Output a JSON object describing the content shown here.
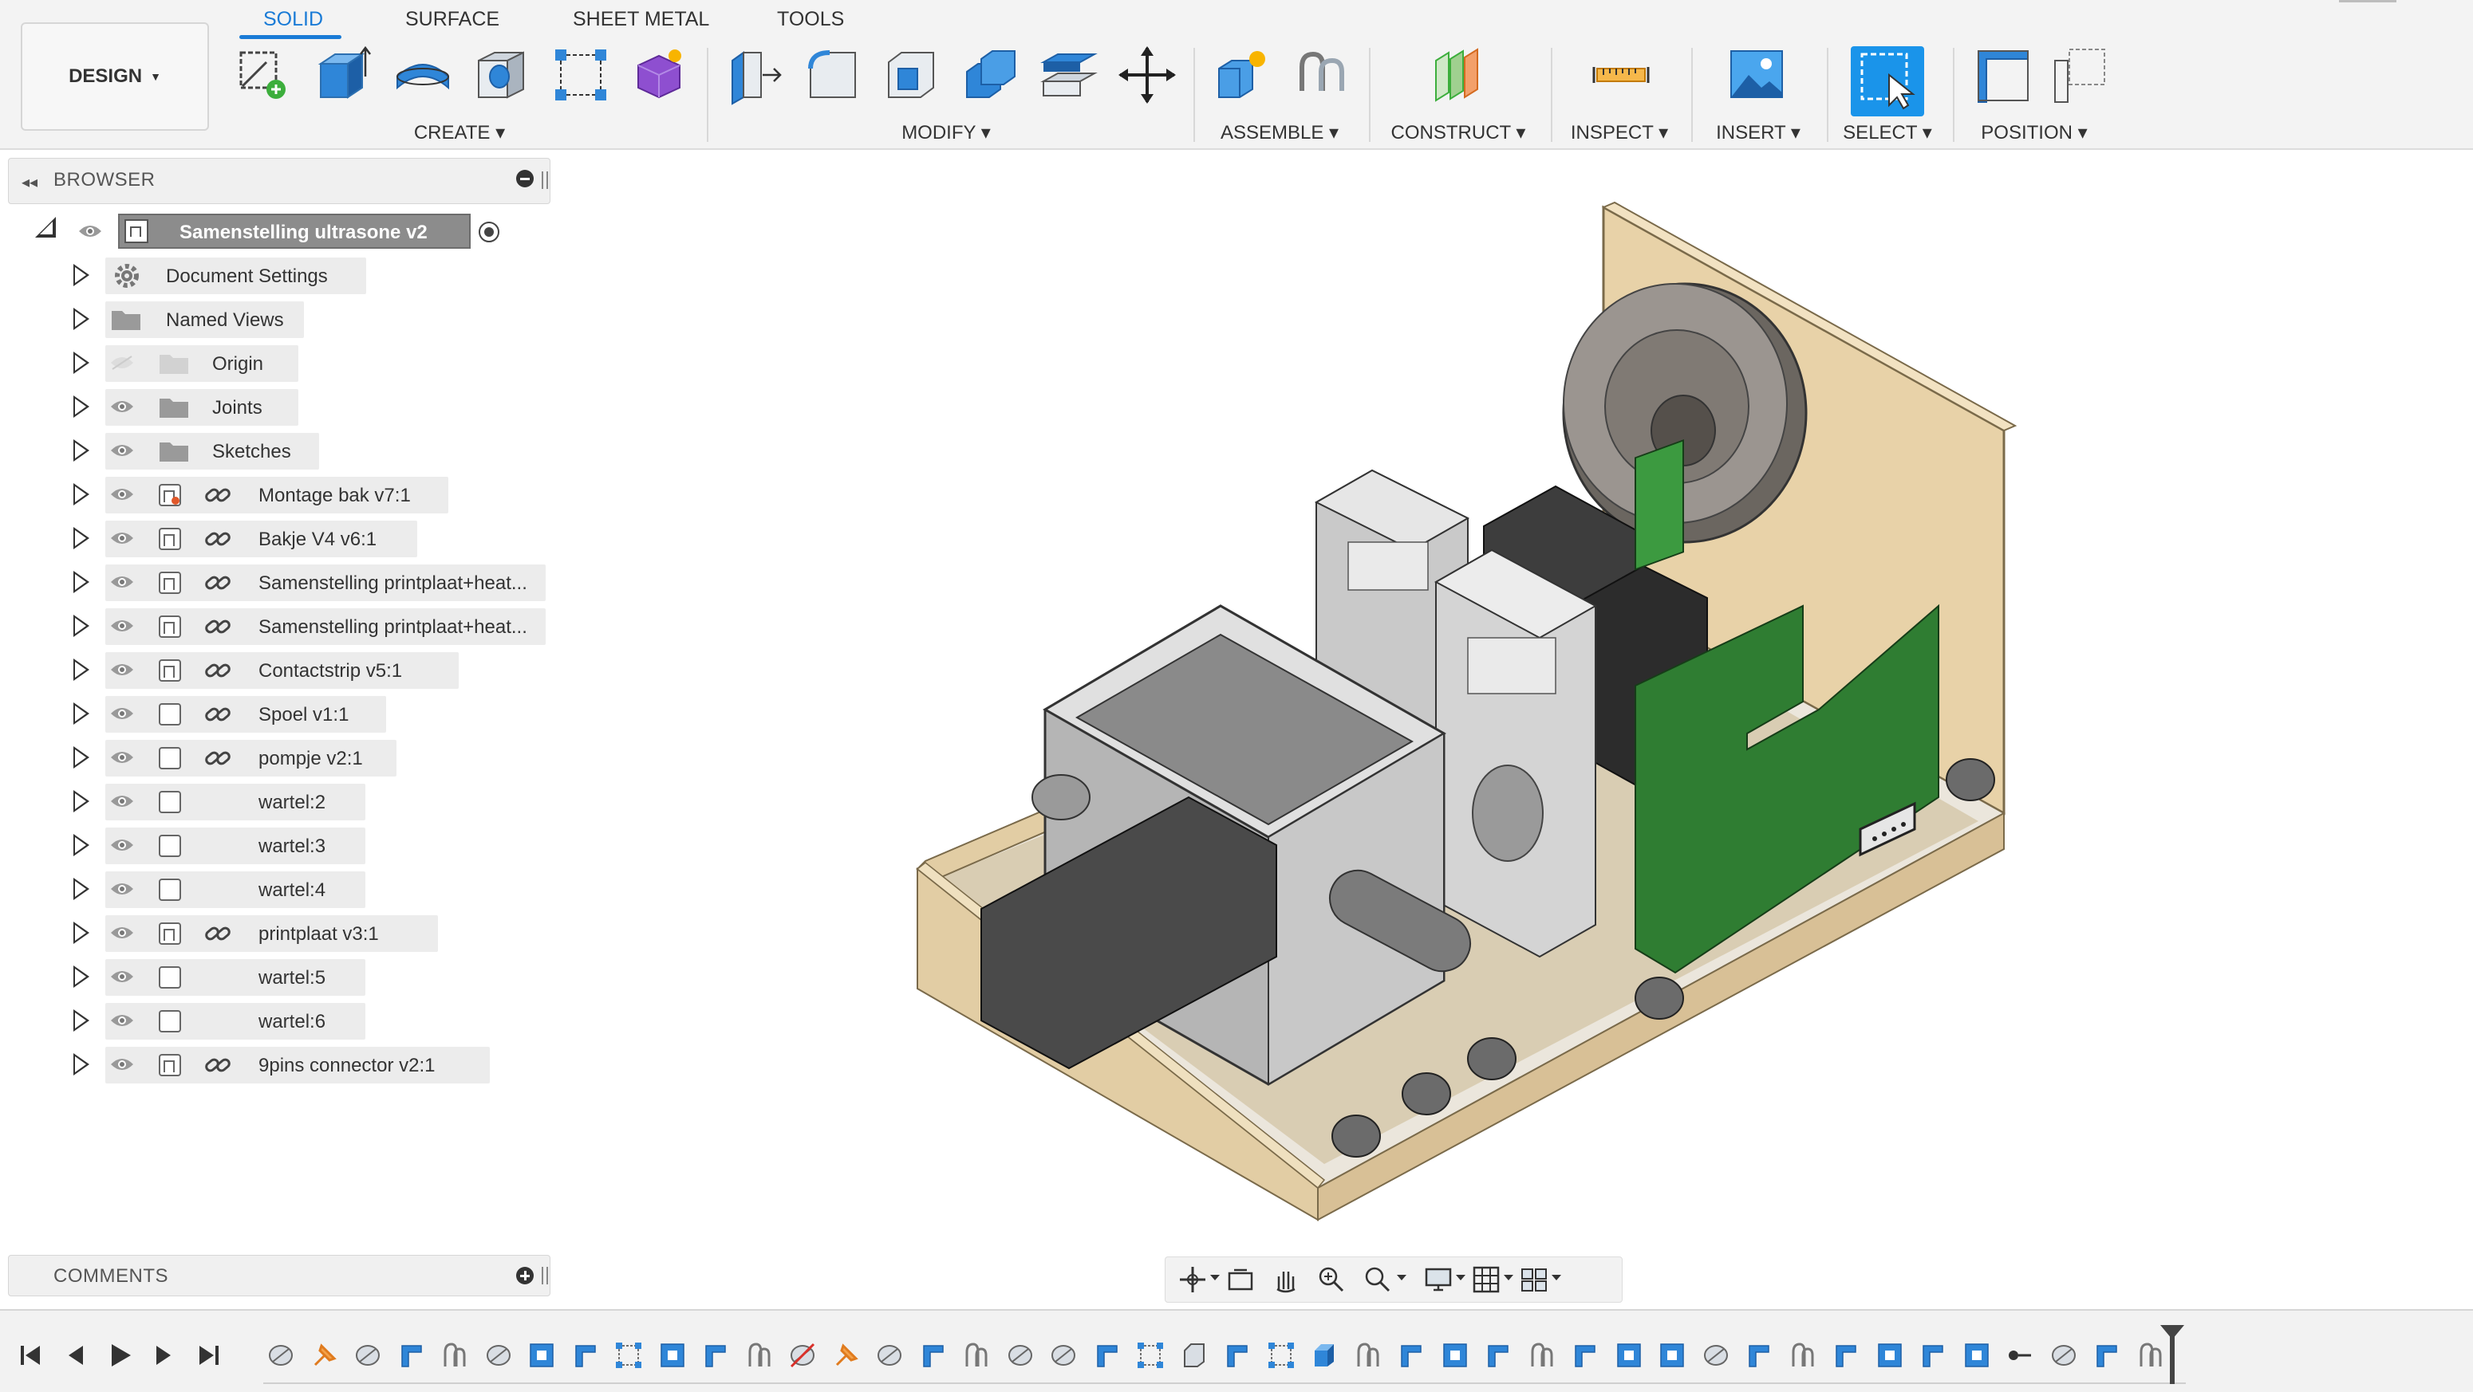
{
  "toolbar": {
    "design_label": "DESIGN",
    "tabs": [
      {
        "label": "SOLID",
        "active": true
      },
      {
        "label": "SURFACE",
        "active": false
      },
      {
        "label": "SHEET METAL",
        "active": false
      },
      {
        "label": "TOOLS",
        "active": false
      }
    ],
    "groups": {
      "create": "CREATE",
      "modify": "MODIFY",
      "assemble": "ASSEMBLE",
      "construct": "CONSTRUCT",
      "inspect": "INSPECT",
      "insert": "INSERT",
      "select": "SELECT",
      "position": "POSITION"
    }
  },
  "browser": {
    "title": "BROWSER",
    "root": "Samenstelling ultrasone v2",
    "items": [
      {
        "label": "Document Settings",
        "icon": "gear-icon"
      },
      {
        "label": "Named Views",
        "icon": "folder-icon"
      },
      {
        "label": "Origin",
        "icon": "folder-icon",
        "hidden": true
      },
      {
        "label": "Joints",
        "icon": "folder-icon"
      },
      {
        "label": "Sketches",
        "icon": "folder-icon"
      },
      {
        "label": "Montage bak v7:1",
        "icon": "component-icon",
        "linked": true
      },
      {
        "label": "Bakje V4 v6:1",
        "icon": "component-icon",
        "linked": true
      },
      {
        "label": "Samenstelling printplaat+heat...",
        "icon": "component-icon",
        "linked": true
      },
      {
        "label": "Samenstelling printplaat+heat...",
        "icon": "component-icon",
        "linked": true
      },
      {
        "label": "Contactstrip v5:1",
        "icon": "component-icon",
        "linked": true
      },
      {
        "label": "Spoel v1:1",
        "icon": "body-icon",
        "linked": true
      },
      {
        "label": "pompje v2:1",
        "icon": "body-icon",
        "linked": true
      },
      {
        "label": "wartel:2",
        "icon": "body-icon",
        "linked": false
      },
      {
        "label": "wartel:3",
        "icon": "body-icon",
        "linked": false
      },
      {
        "label": "wartel:4",
        "icon": "body-icon",
        "linked": false
      },
      {
        "label": "printplaat v3:1",
        "icon": "component-icon",
        "linked": true
      },
      {
        "label": "wartel:5",
        "icon": "body-icon",
        "linked": false
      },
      {
        "label": "wartel:6",
        "icon": "body-icon",
        "linked": false
      },
      {
        "label": "9pins connector v2:1",
        "icon": "component-icon",
        "linked": true
      }
    ]
  },
  "comments": {
    "title": "COMMENTS"
  },
  "colors": {
    "accent": "#1a7bd6",
    "select_blue": "#1a94ea",
    "wood": "#e2cda4",
    "pcb_green": "#2f7d32"
  }
}
